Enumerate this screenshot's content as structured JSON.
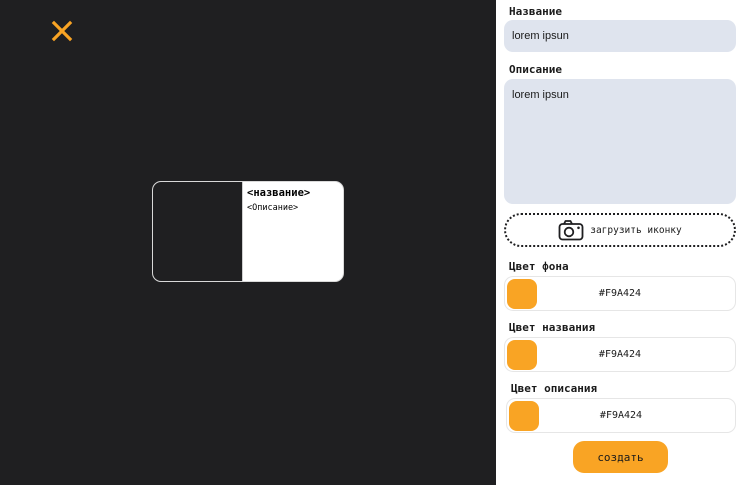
{
  "colors": {
    "accent": "#F9A424",
    "dark_background": "#1F1F21",
    "input_background": "#DFE4EE"
  },
  "header": {
    "close_icon": "close-icon"
  },
  "preview_card": {
    "title": "<название>",
    "description": "<Описание>"
  },
  "form": {
    "name_label": "Название",
    "name_value": "lorem ipsun",
    "description_label": "Описание",
    "description_value": "lorem ipsun",
    "upload_icon": "camera-icon",
    "upload_label": "загрузить иконку",
    "bg_color_label": "Цвет фона",
    "bg_color_value": "#F9A424",
    "title_color_label": "Цвет названия",
    "title_color_value": "#F9A424",
    "desc_color_label": "Цвет описания",
    "desc_color_value": "#F9A424",
    "create_label": "создать"
  }
}
